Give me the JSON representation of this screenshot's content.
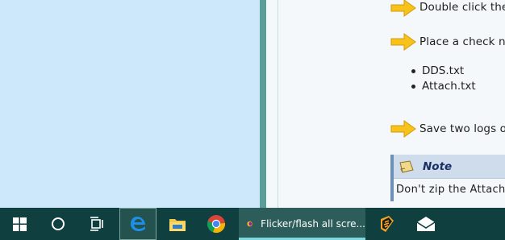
{
  "steps": [
    {
      "text": "Double click the"
    },
    {
      "text": "Place a check n"
    },
    {
      "text": "Save two logs o"
    }
  ],
  "files": [
    "DDS.txt",
    "Attach.txt"
  ],
  "note": {
    "title": "Note",
    "body": "Don't zip the Attach"
  },
  "taskbar": {
    "firefox_label": "Flicker/flash all scre...",
    "icons": [
      "windows-start-icon",
      "cortana-search-icon",
      "task-view-icon",
      "edge-icon",
      "file-explorer-icon",
      "chrome-icon",
      "firefox-icon",
      "winamp-icon",
      "mail-icon"
    ]
  },
  "colors": {
    "desktop": "#cde8fb",
    "window_border": "#5a9e98",
    "taskbar": "#0f3f3f",
    "taskbar_active_underline": "#80d8df",
    "note_header": "#cfdcec",
    "note_title": "#1a2f66",
    "arrow": "#f7c21a"
  }
}
